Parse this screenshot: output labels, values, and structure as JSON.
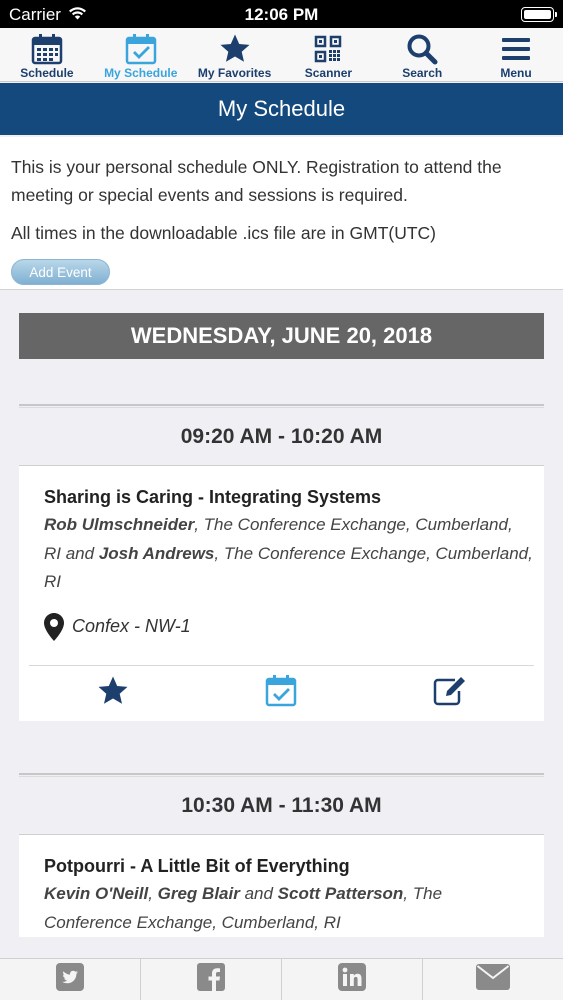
{
  "status_bar": {
    "carrier": "Carrier",
    "time": "12:06 PM"
  },
  "nav": {
    "items": [
      {
        "label": "Schedule",
        "icon": "calendar-icon"
      },
      {
        "label": "My Schedule",
        "icon": "calendar-check-icon",
        "active": true
      },
      {
        "label": "My Favorites",
        "icon": "star-icon"
      },
      {
        "label": "Scanner",
        "icon": "qr-code-icon"
      },
      {
        "label": "Search",
        "icon": "search-icon"
      },
      {
        "label": "Menu",
        "icon": "hamburger-menu-icon"
      }
    ]
  },
  "page": {
    "title": "My Schedule"
  },
  "info": {
    "notice": "This is your personal schedule ONLY. Registration to attend the meeting or special events and sessions is required.",
    "ics_note": "All times in the downloadable .ics file are in GMT(UTC)",
    "add_event_label": "Add Event"
  },
  "schedule": {
    "day_header": "WEDNESDAY, JUNE 20, 2018",
    "sessions": [
      {
        "time": "09:20 AM - 10:20 AM",
        "title": "Sharing is Caring - Integrating Systems",
        "speaker1": "Rob Ulmschneider",
        "speaker1_affil": ", The Conference Exchange, Cumberland, RI and ",
        "speaker2": "Josh Andrews",
        "speaker2_affil": ", The Conference Exchange, Cumberland, RI",
        "location": "Confex - NW-1"
      },
      {
        "time": "10:30 AM - 11:30 AM",
        "title": "Potpourri - A Little Bit of Everything",
        "speaker1": "Kevin O'Neill",
        "sep1": ", ",
        "speaker2": "Greg Blair",
        "sep2": " and ",
        "speaker3": "Scott Patterson",
        "affil": ", The Conference Exchange, Cumberland, RI"
      }
    ]
  },
  "share": [
    "twitter-icon",
    "facebook-icon",
    "linkedin-icon",
    "email-icon"
  ],
  "colors": {
    "brand_blue": "#14497e",
    "nav_blue": "#1c3f6e",
    "active_blue": "#3aa4dc"
  }
}
